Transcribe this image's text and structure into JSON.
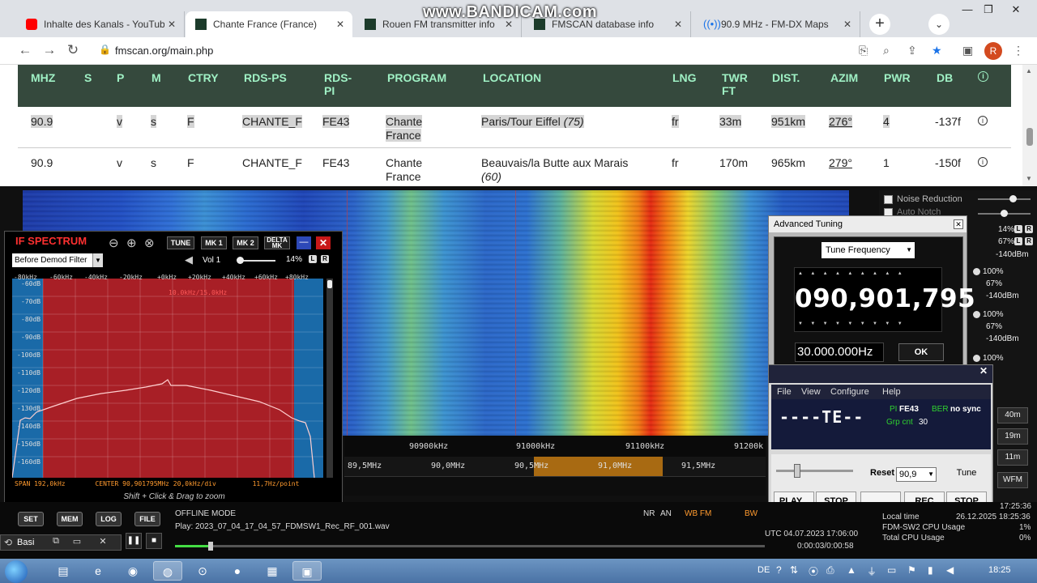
{
  "browser": {
    "tabs": [
      {
        "title": "Inhalte des Kanals - YouTube S",
        "icon": "youtube-icon",
        "color": "#ff0000"
      },
      {
        "title": "Chante France (France)",
        "icon": "fmscan-icon",
        "color": "#1c3b2b",
        "active": true
      },
      {
        "title": "Rouen FM transmitter info",
        "icon": "fmscan-icon",
        "color": "#1c3b2b"
      },
      {
        "title": "FMSCAN database info",
        "icon": "fmscan-icon",
        "color": "#1c3b2b"
      },
      {
        "title": "90.9 MHz - FM-DX Maps",
        "icon": "broadcast-icon",
        "color": "#1a73e8"
      }
    ],
    "url": "fmscan.org/main.php",
    "watermark": "www.BANDICAM.com",
    "avatar": "R"
  },
  "fmscan": {
    "headers": [
      "MHZ",
      "S",
      "P",
      "M",
      "CTRY",
      "RDS-PS",
      "RDS-\nPI",
      "PROGRAM",
      "LOCATION",
      "LNG",
      "TWR\nFT",
      "DIST.",
      "AZIM",
      "PWR",
      "DB"
    ],
    "rows": [
      {
        "mhz": "90.9",
        "s": "",
        "p": "v",
        "m": "s",
        "ctry": "F",
        "ps": "CHANTE_F",
        "pi": "FE43",
        "program": "Chante France",
        "location": "Paris/Tour Eiffel",
        "loc_note": "(75)",
        "lng": "fr",
        "twr": "33m",
        "dist": "951km",
        "azim": "276°",
        "pwr": "4",
        "db": "-137f"
      },
      {
        "mhz": "90.9",
        "s": "",
        "p": "v",
        "m": "s",
        "ctry": "F",
        "ps": "CHANTE_F",
        "pi": "FE43",
        "program": "Chante France",
        "location": "Beauvais/la Butte aux Marais",
        "loc_note": "(60)",
        "lng": "fr",
        "twr": "170m",
        "dist": "965km",
        "azim": "279°",
        "pwr": "1",
        "db": "-150f"
      }
    ]
  },
  "if_spectrum": {
    "title": "IF SPECTRUM",
    "buttons": [
      "TUNE",
      "MK 1",
      "MK 2",
      "DELTA\nMK"
    ],
    "filter": "Before Demod Filter",
    "vol_label": "Vol 1",
    "vol_pct": "14%",
    "db_labels": [
      "-60dB",
      "-70dB",
      "-80dB",
      "-90dB",
      "-100dB",
      "-110dB",
      "-120dB",
      "-130dB",
      "-140dB",
      "-150dB",
      "-160dB"
    ],
    "khz_labels": [
      "-80kHz",
      "-60kHz",
      "-40kHz",
      "-20kHz",
      "+0kHz",
      "+20kHz",
      "+40kHz",
      "+60kHz",
      "+80kHz"
    ],
    "filter_label": "10.0kHz/15.0kHz",
    "span": "SPAN 192,0kHz",
    "center": "CENTER 90,901795MHz",
    "div": "20,0kHz/div",
    "resolution": "11,7Hz/point",
    "hint": "Shift + Click & Drag to zoom"
  },
  "freq_scale": [
    "90900kHz",
    "91000kHz",
    "91100kHz",
    "91200k"
  ],
  "band_scale": [
    "89,5MHz",
    "90,0MHz",
    "90,5MHz",
    "91,0MHz",
    "91,5MHz"
  ],
  "right_panel": {
    "noise_reduction": "Noise Reduction",
    "auto_notch": "Auto Notch",
    "levels": [
      {
        "a": "14%",
        "b": "67%",
        "c": "-140dBm"
      },
      {
        "a": "100%",
        "b": "67%",
        "c": "-140dBm"
      },
      {
        "a": "100%",
        "b": "67%",
        "c": "-140dBm"
      },
      {
        "a": "100%",
        "b": "",
        "c": ""
      }
    ],
    "bands": [
      "40m",
      "19m",
      "11m",
      "WFM"
    ]
  },
  "advanced_tuning": {
    "title": "Advanced Tuning",
    "mode": "Tune Frequency",
    "frequency": "090,901,795",
    "step": "30.000.000Hz",
    "ok": "OK"
  },
  "rds": {
    "menu": [
      "File",
      "View",
      "Configure",
      "Help"
    ],
    "ps": "----TE--",
    "pi_label": "PI",
    "pi_value": "FE43",
    "ber_label": "BER",
    "ber_value": "no sync",
    "grp_label": "Grp cnt",
    "grp_value": "30",
    "reset": "Reset",
    "freq": "90,9",
    "tune": "Tune",
    "play": "PLAY...",
    "stop1": "STOP",
    "dots": "...",
    "rec": "REC",
    "stop2": "STOP"
  },
  "bottom": {
    "buttons": [
      "SET",
      "MEM",
      "LOG",
      "FILE"
    ],
    "offline": "OFFLINE MODE",
    "play": "Play: 2023_07_04_17_04_57_FDMSW1_Rec_RF_001.wav",
    "nr": "NR",
    "an": "AN",
    "wbfm": "WB FM",
    "bw": "BW",
    "utc": "UTC 04.07.2023 17:06:00",
    "ptime": "0:00:03/0:00:58",
    "progress": 0.06,
    "local_time_label": "Local time",
    "local_time": "26.12.2025 18:25:36",
    "cpu1_label": "FDM-SW2 CPU Usage",
    "cpu1": "1%",
    "cpu2_label": "Total CPU Usage",
    "cpu2": "0%",
    "time_right": "17:25:36",
    "basic": "Basi"
  },
  "taskbar": {
    "lang": "DE",
    "clock": "18:25"
  }
}
